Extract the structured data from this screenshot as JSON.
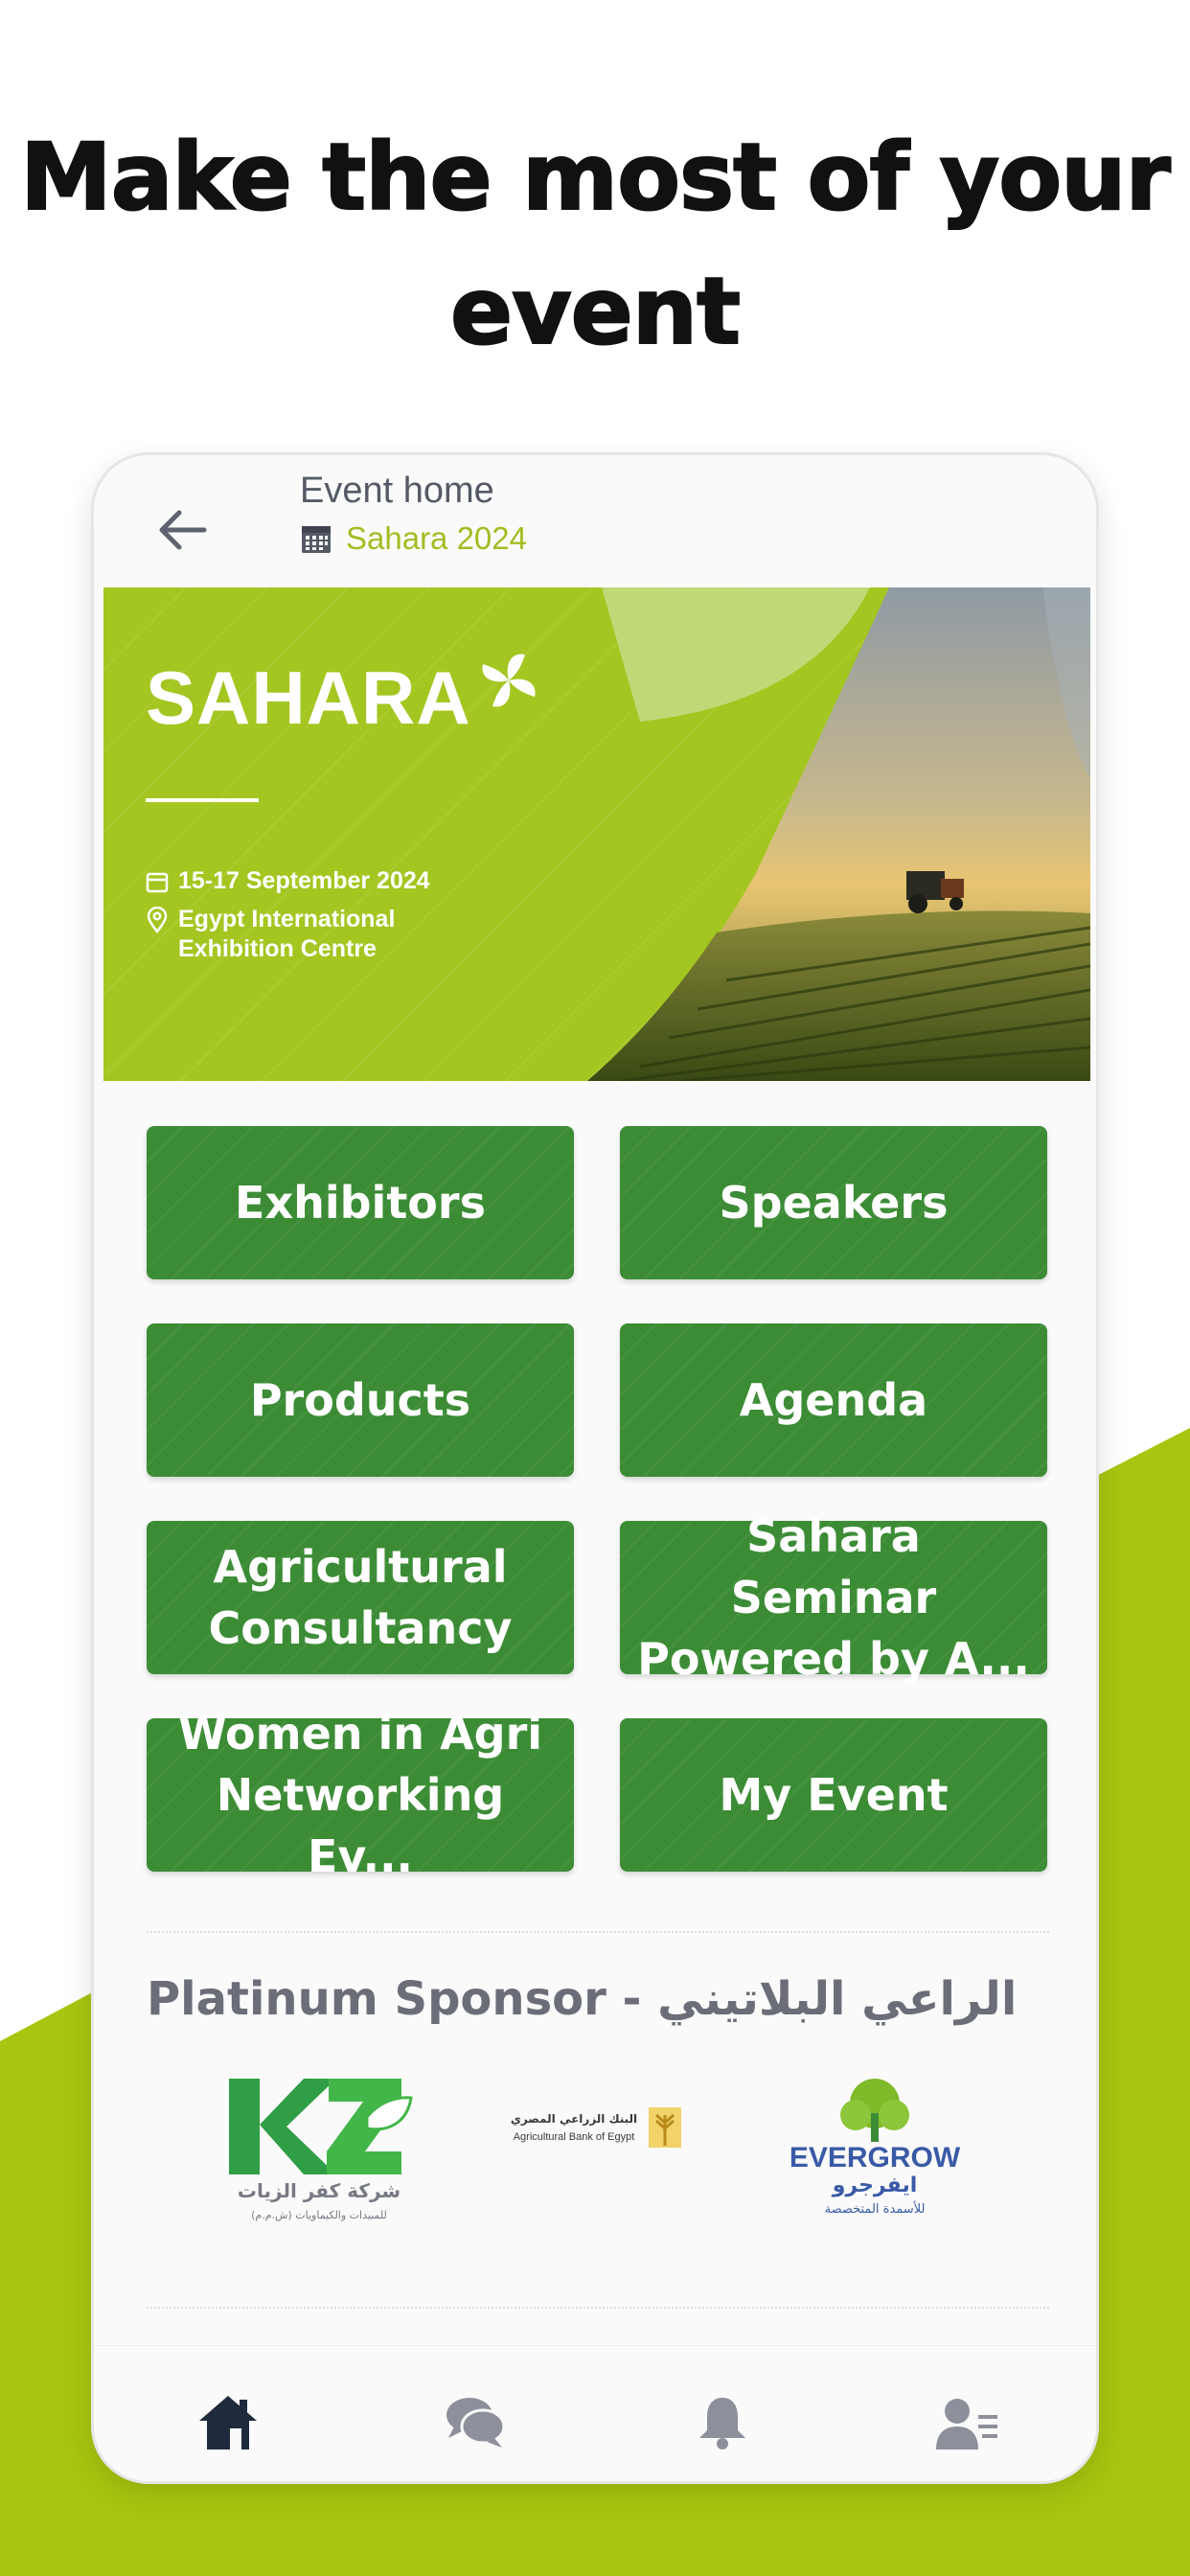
{
  "headline": {
    "line1": "Make the most of your",
    "line2": "event"
  },
  "colors": {
    "accent_lime": "#a8c50f",
    "tile_green": "#3c8c36",
    "subtitle_lime": "#a2bd22"
  },
  "topbar": {
    "title": "Event home",
    "event_name": "Sahara 2024",
    "back_icon": "arrow-left-icon",
    "calendar_icon": "calendar-icon"
  },
  "banner": {
    "brand": "SAHARA",
    "dates": "15-17 September 2024",
    "location_line1": "Egypt International",
    "location_line2": "Exhibition Centre"
  },
  "tiles": [
    {
      "label": "Exhibitors"
    },
    {
      "label": "Speakers"
    },
    {
      "label": "Products"
    },
    {
      "label": "Agenda"
    },
    {
      "label": "Agricultural Consultancy"
    },
    {
      "label": "Sahara Seminar Powered by A..."
    },
    {
      "label": "Women in Agri Networking Ev..."
    },
    {
      "label": "My Event"
    }
  ],
  "sponsors": {
    "heading": "Platinum Sponsor - الراعي البلاتيني",
    "logos": [
      {
        "name": "kz-logo",
        "text_main": "KZ",
        "text_ar": "شركة كفر الزيات",
        "text_ar_sub": "للمبيدات والكيماويات (ش.م.م)"
      },
      {
        "name": "agri-bank-logo",
        "text_ar": "البنك الزراعي المصري",
        "text_en": "Agricultural Bank of Egypt"
      },
      {
        "name": "evergrow-logo",
        "text_en": "EVERGROW",
        "text_ar": "ايفرجرو",
        "text_ar_sub": "للأسمدة المتخصصة"
      }
    ]
  },
  "bottom_nav": [
    {
      "icon": "home-icon",
      "active": true
    },
    {
      "icon": "chat-icon",
      "active": false
    },
    {
      "icon": "bell-icon",
      "active": false
    },
    {
      "icon": "profile-icon",
      "active": false
    }
  ]
}
